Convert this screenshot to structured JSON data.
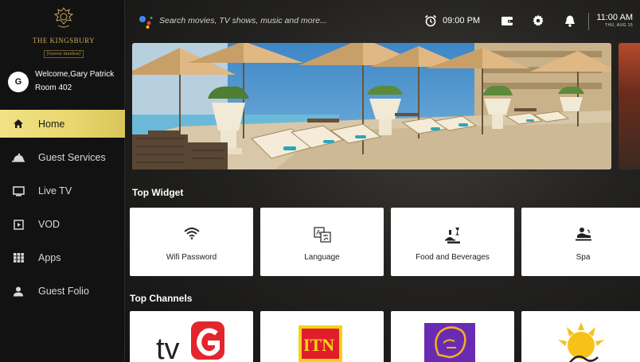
{
  "brand": {
    "name": "THE KINGSBURY",
    "tagline": "[forever timeless]"
  },
  "user": {
    "initial": "G",
    "welcome": "Welcome,Gary Patrick",
    "room": "Room 402"
  },
  "nav": {
    "items": [
      {
        "label": "Home",
        "icon": "home-icon",
        "active": true
      },
      {
        "label": "Guest Services",
        "icon": "room-service-icon"
      },
      {
        "label": "Live TV",
        "icon": "tv-icon"
      },
      {
        "label": "VOD",
        "icon": "play-icon"
      },
      {
        "label": "Apps",
        "icon": "apps-grid-icon"
      },
      {
        "label": "Guest Folio",
        "icon": "person-icon"
      }
    ]
  },
  "topbar": {
    "search_placeholder": "Search movies, TV shows, music and more...",
    "alarm_time": "09:00 PM",
    "clock_time": "11:00 AM",
    "clock_date": "THU, AUG 15"
  },
  "sections": {
    "widgets_title": "Top Widget",
    "channels_title": "Top Channels"
  },
  "widgets": [
    {
      "label": "Wifi Password",
      "icon": "wifi-icon"
    },
    {
      "label": "Language",
      "icon": "translate-icon"
    },
    {
      "label": "Food and Beverages",
      "icon": "food-beverage-icon"
    },
    {
      "label": "Spa",
      "icon": "spa-icon"
    }
  ],
  "channels": [
    {
      "label": "tv",
      "icon": "tv-derana-logo"
    },
    {
      "label": "ITN",
      "icon": "itn-logo"
    },
    {
      "label": "",
      "icon": "lion-logo"
    },
    {
      "label": "",
      "icon": "sun-logo"
    }
  ],
  "colors": {
    "accent": "#E8D66D",
    "sidebar": "#121212",
    "card": "#FFFFFF"
  }
}
